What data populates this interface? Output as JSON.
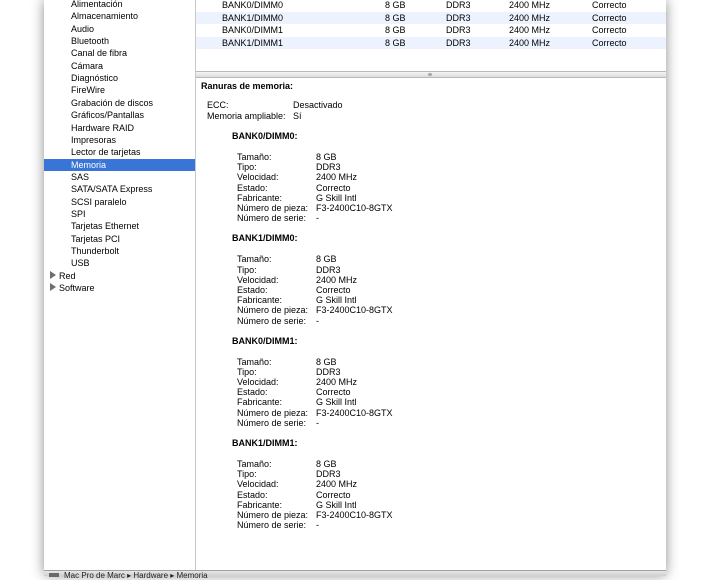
{
  "sidebar": {
    "items": [
      "Alimentación",
      "Almacenamiento",
      "Audio",
      "Bluetooth",
      "Canal de fibra",
      "Cámara",
      "Diagnóstico",
      "FireWire",
      "Grabación de discos",
      "Gráficos/Pantallas",
      "Hardware RAID",
      "Impresoras",
      "Lector de tarjetas",
      "Memoria",
      "SAS",
      "SATA/SATA Express",
      "SCSI paralelo",
      "SPI",
      "Tarjetas Ethernet",
      "Tarjetas PCI",
      "Thunderbolt",
      "USB"
    ],
    "selected": "Memoria",
    "groups": [
      "Red",
      "Software"
    ]
  },
  "table": {
    "rows": [
      [
        "BANK0/DIMM0",
        "8 GB",
        "DDR3",
        "2400 MHz",
        "Correcto"
      ],
      [
        "BANK1/DIMM0",
        "8 GB",
        "DDR3",
        "2400 MHz",
        "Correcto"
      ],
      [
        "BANK0/DIMM1",
        "8 GB",
        "DDR3",
        "2400 MHz",
        "Correcto"
      ],
      [
        "BANK1/DIMM1",
        "8 GB",
        "DDR3",
        "2400 MHz",
        "Correcto"
      ]
    ]
  },
  "detail": {
    "heading": "Ranuras de memoria:",
    "ecc_label": "ECC:",
    "ecc_value": "Desactivado",
    "upgradeable_label": "Memoria ampliable:",
    "upgradeable_value": "Sí",
    "labels": [
      "Tamaño:",
      "Tipo:",
      "Velocidad:",
      "Estado:",
      "Fabricante:",
      "Número de pieza:",
      "Número de serie:"
    ],
    "slots": [
      {
        "name": "BANK0/DIMM0:",
        "values": [
          "8 GB",
          "DDR3",
          "2400 MHz",
          "Correcto",
          "G Skill Intl",
          "F3-2400C10-8GTX",
          "-"
        ]
      },
      {
        "name": "BANK1/DIMM0:",
        "values": [
          "8 GB",
          "DDR3",
          "2400 MHz",
          "Correcto",
          "G Skill Intl",
          "F3-2400C10-8GTX",
          "-"
        ]
      },
      {
        "name": "BANK0/DIMM1:",
        "values": [
          "8 GB",
          "DDR3",
          "2400 MHz",
          "Correcto",
          "G Skill Intl",
          "F3-2400C10-8GTX",
          "-"
        ]
      },
      {
        "name": "BANK1/DIMM1:",
        "values": [
          "8 GB",
          "DDR3",
          "2400 MHz",
          "Correcto",
          "G Skill Intl",
          "F3-2400C10-8GTX",
          "-"
        ]
      }
    ]
  },
  "statusbar": {
    "text": "Mac Pro de Marc ▸ Hardware ▸ Memoria"
  },
  "colors": {
    "selection": "#3875d7",
    "alt_row": "#edf3fe"
  }
}
